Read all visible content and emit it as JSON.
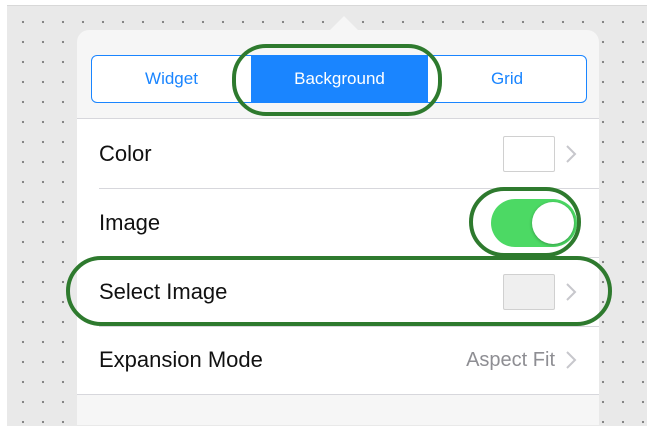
{
  "segmented_control": {
    "tabs": [
      {
        "label": "Widget",
        "selected": false
      },
      {
        "label": "Background",
        "selected": true
      },
      {
        "label": "Grid",
        "selected": false
      }
    ]
  },
  "settings": {
    "rows": [
      {
        "label": "Color",
        "accessory": "color-swatch",
        "swatch_color": "#ffffff"
      },
      {
        "label": "Image",
        "accessory": "toggle",
        "toggle_on": true
      },
      {
        "label": "Select Image",
        "accessory": "image-swatch",
        "swatch_color": "#efefef"
      },
      {
        "label": "Expansion Mode",
        "accessory": "value",
        "value": "Aspect Fit"
      }
    ]
  },
  "colors": {
    "accent": "#1a85ff",
    "toggle_on": "#4cd964",
    "highlight_outline": "#2e7a2e"
  }
}
